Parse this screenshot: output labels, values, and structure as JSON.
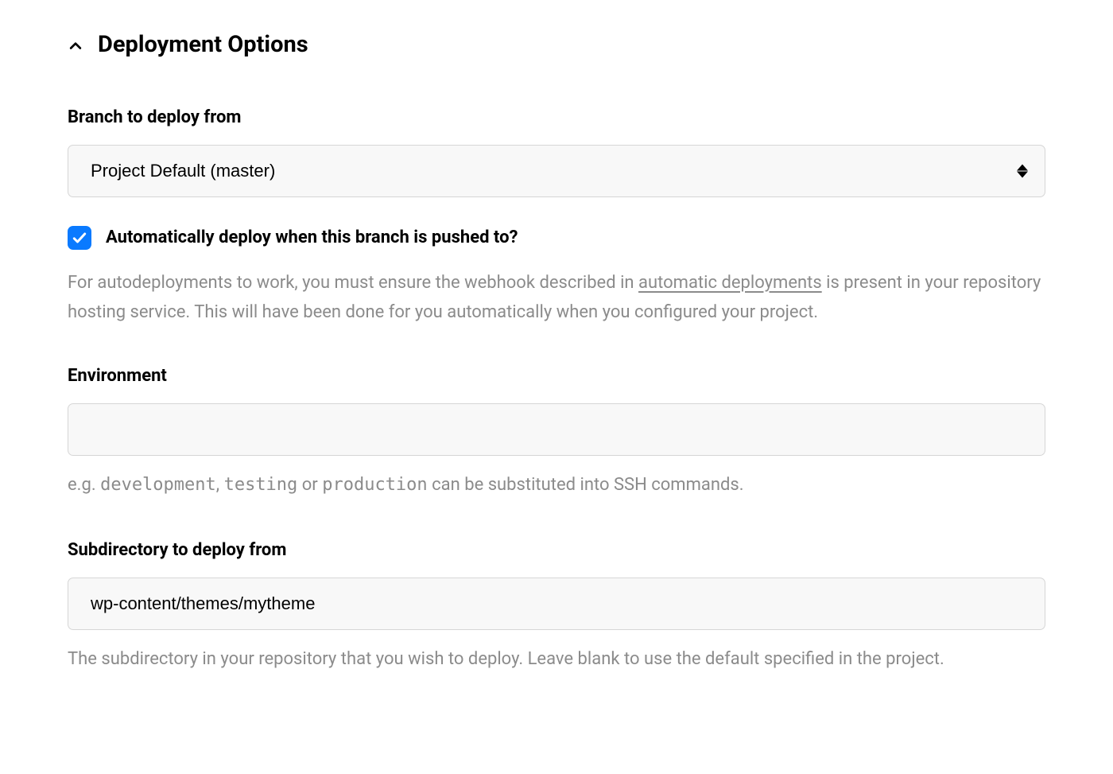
{
  "section": {
    "title": "Deployment Options"
  },
  "branch": {
    "label": "Branch to deploy from",
    "selected": "Project Default (master)"
  },
  "auto_deploy": {
    "label": "Automatically deploy when this branch is pushed to?",
    "checked": true,
    "help_prefix": "For autodeployments to work, you must ensure the webhook described in ",
    "help_link": "automatic deployments",
    "help_suffix": " is present in your repository hosting service. This will have been done for you automatically when you configured your project."
  },
  "environment": {
    "label": "Environment",
    "value": "",
    "hint_prefix": "e.g. ",
    "hint_code1": "development",
    "hint_sep1": ", ",
    "hint_code2": "testing",
    "hint_sep2": " or ",
    "hint_code3": "production",
    "hint_suffix": " can be substituted into SSH commands."
  },
  "subdirectory": {
    "label": "Subdirectory to deploy from",
    "value": "wp-content/themes/mytheme",
    "hint": "The subdirectory in your repository that you wish to deploy. Leave blank to use the default specified in the project."
  }
}
